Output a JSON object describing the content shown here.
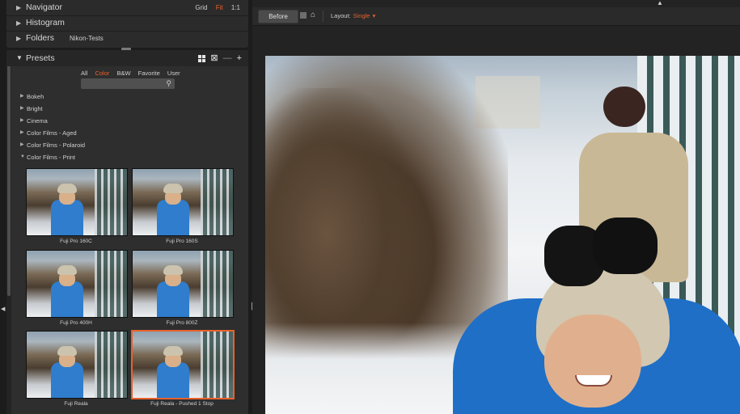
{
  "top_panels": {
    "navigator": {
      "label": "Navigator",
      "options": [
        "Grid",
        "Fit",
        "1:1"
      ],
      "active_option": "Fit"
    },
    "histogram": {
      "label": "Histogram"
    },
    "folders": {
      "label": "Folders",
      "value": "Nikon-Tests"
    }
  },
  "presets": {
    "title": "Presets",
    "filters": [
      "All",
      "Color",
      "B&W",
      "Favorite",
      "User"
    ],
    "active_filter": "Color",
    "search": {
      "placeholder": "",
      "value": ""
    },
    "categories": [
      {
        "label": "Bokeh",
        "expanded": false
      },
      {
        "label": "Bright",
        "expanded": false
      },
      {
        "label": "Cinema",
        "expanded": false
      },
      {
        "label": "Color Films - Aged",
        "expanded": false
      },
      {
        "label": "Color Films - Polaroid",
        "expanded": false
      },
      {
        "label": "Color Films - Print",
        "expanded": true
      }
    ],
    "thumbnails": [
      {
        "label": "Fuji Pro 160C",
        "selected": false
      },
      {
        "label": "Fuji Pro 160S",
        "selected": false
      },
      {
        "label": "Fuji Pro 400H",
        "selected": false
      },
      {
        "label": "Fuji Pro 800Z",
        "selected": false
      },
      {
        "label": "Fuji Reala",
        "selected": false
      },
      {
        "label": "Fuji Reala - Pushed 1 Stop",
        "selected": true
      }
    ]
  },
  "toolbar": {
    "before_label": "Before",
    "layout_label": "Layout:",
    "layout_value": "Single"
  },
  "colors": {
    "accent": "#e8612c",
    "panel": "#2e2e2e",
    "background": "#1c1c1c"
  },
  "icons": [
    "grid-view-icon",
    "compare-view-icon",
    "minus-icon",
    "plus-icon",
    "search-icon",
    "wand-icon"
  ]
}
